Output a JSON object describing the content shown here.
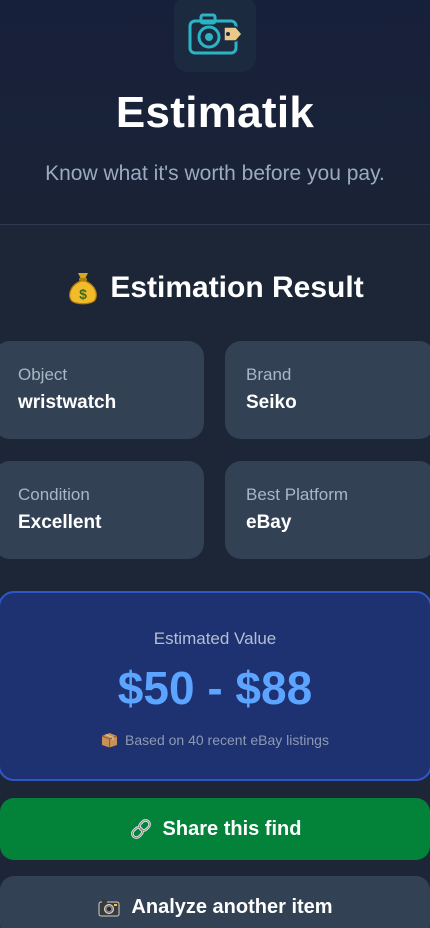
{
  "header": {
    "title": "Estimatik",
    "tagline": "Know what it's worth before you pay.",
    "logo_icon": "camera-price-tag-icon",
    "accent_color": "#2bb5c4"
  },
  "result": {
    "title": "Estimation Result",
    "title_icon": "money-bag-icon",
    "cards": {
      "object": {
        "label": "Object",
        "value": "wristwatch"
      },
      "brand": {
        "label": "Brand",
        "value": "Seiko"
      },
      "condition": {
        "label": "Condition",
        "value": "Excellent"
      },
      "platform": {
        "label": "Best Platform",
        "value": "eBay"
      }
    }
  },
  "estimate": {
    "label": "Estimated Value",
    "value": "$50 - $88",
    "note": "Based on 40 recent eBay listings",
    "note_icon": "package-icon",
    "value_color": "#5ba4ff"
  },
  "actions": {
    "share_label": "Share this find",
    "share_icon": "link-icon",
    "share_color": "#03833a",
    "analyze_label": "Analyze another item",
    "analyze_icon": "camera-icon"
  }
}
